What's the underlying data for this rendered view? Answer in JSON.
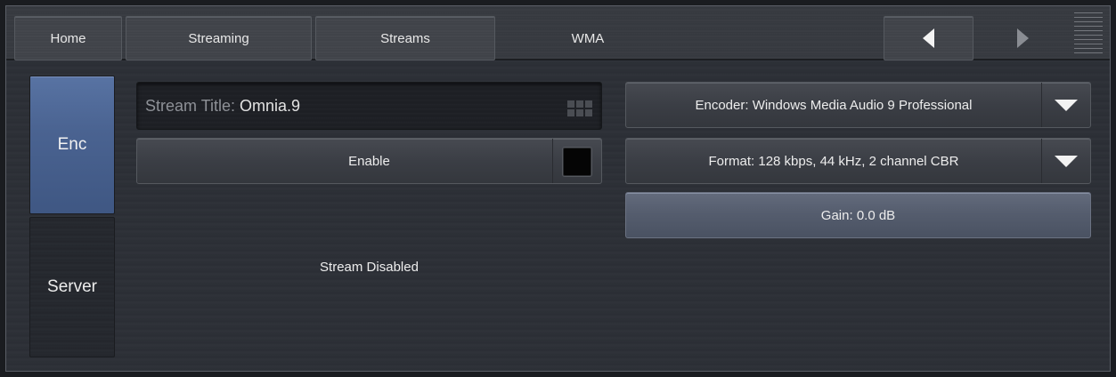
{
  "nav": {
    "home": "Home",
    "streaming": "Streaming",
    "streams": "Streams",
    "wma": "WMA"
  },
  "icons": {
    "back": "left-triangle-icon",
    "forward": "right-triangle-icon",
    "menu": "hamburger-lines-icon",
    "keypad": "keypad-icon",
    "dropdown": "down-triangle-icon"
  },
  "side": {
    "enc": "Enc",
    "server": "Server"
  },
  "stream_title": {
    "label": "Stream Title:",
    "value": "Omnia.9"
  },
  "enable": {
    "label": "Enable",
    "checked": false
  },
  "status": "Stream Disabled",
  "encoder": "Encoder: Windows Media Audio 9 Professional",
  "format": "Format: 128 kbps, 44 kHz, 2 channel CBR",
  "gain": "Gain: 0.0 dB",
  "colors": {
    "selected_tab": "#4a6391",
    "gain_button": "#555d6e",
    "background": "#2d3037"
  }
}
